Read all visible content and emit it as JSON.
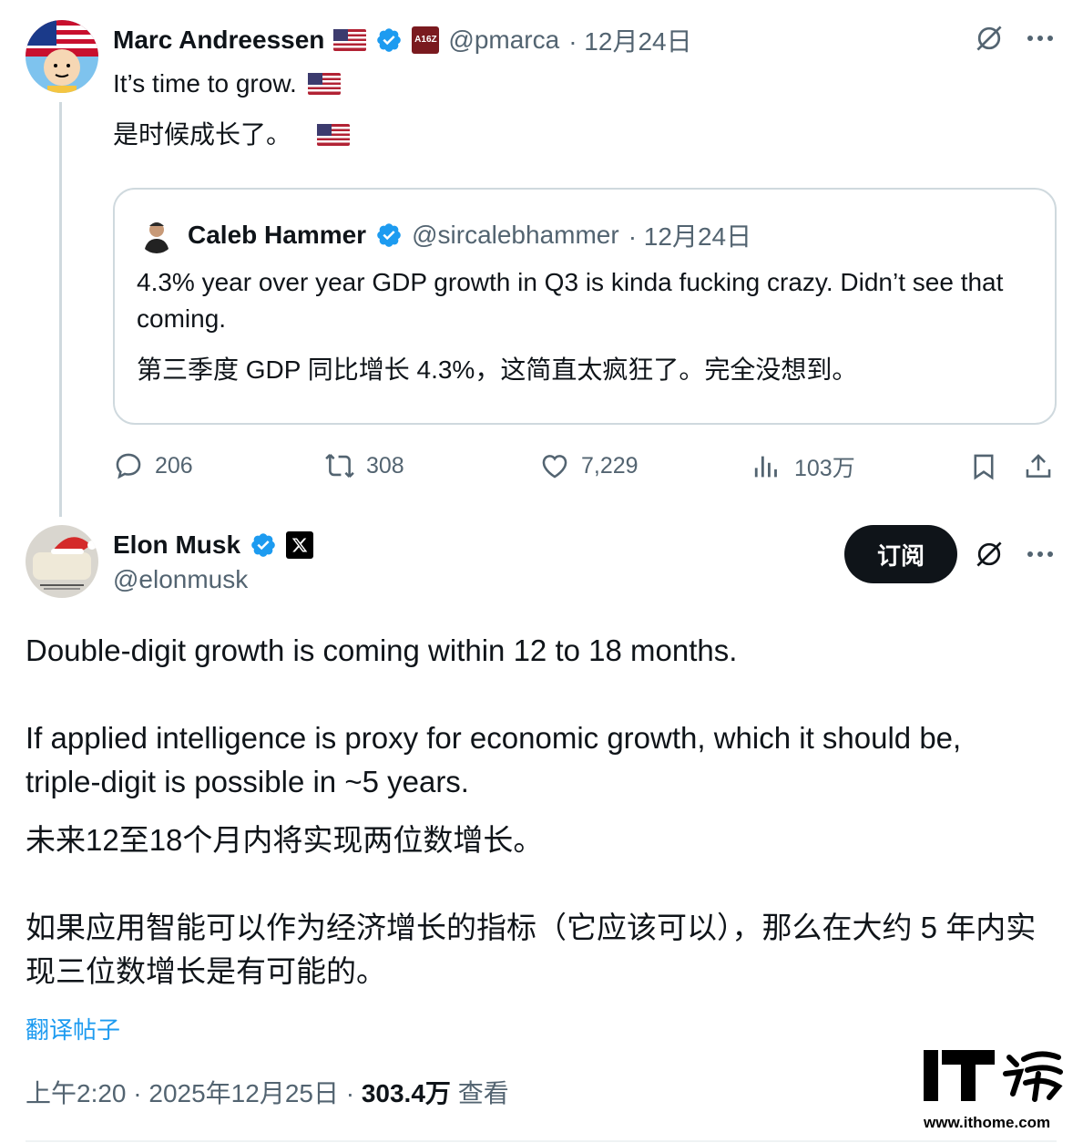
{
  "quoted_thread": {
    "author": {
      "name": "Marc Andreessen",
      "handle": "@pmarca",
      "date": "· 12月24日",
      "badge_text": "A16Z"
    },
    "text_en": "It’s time to grow.",
    "text_zh": "是时候成长了。",
    "quote": {
      "name": "Caleb Hammer",
      "handle": "@sircalebhammer",
      "date": "· 12月24日",
      "text_en": "4.3% year over year GDP growth in Q3 is kinda fucking crazy. Didn’t see that coming.",
      "text_zh": "第三季度 GDP 同比增长 4.3%，这简直太疯狂了。完全没想到。"
    },
    "actions": {
      "replies": "206",
      "reposts": "308",
      "likes": "7,229",
      "views": "103万"
    }
  },
  "main_post": {
    "author": {
      "name": "Elon Musk",
      "handle": "@elonmusk"
    },
    "subscribe_label": "订阅",
    "paragraphs_en": [
      "Double-digit growth is coming within 12 to 18 months.",
      "If applied intelligence is proxy for economic growth, which it should be, triple-digit is possible in ~5 years."
    ],
    "paragraphs_zh": [
      "未来12至18个月内将实现两位数增长。",
      "如果应用智能可以作为经济增长的指标（它应该可以），那么在大约 5 年内实现三位数增长是有可能的。"
    ],
    "translate_label": "翻译帖子",
    "timestamp": "上午2:20 · 2025年12月25日 ·",
    "view_count": "303.4万",
    "view_label": "查看"
  },
  "watermark": {
    "brand": "IT之家",
    "url": "www.ithome.com"
  },
  "colors": {
    "text": "#0f1419",
    "muted": "#536471",
    "link": "#1d9bf0",
    "verified": "#1d9bf0",
    "border": "#cfd9de"
  },
  "icons": [
    "verified-icon",
    "us-flag-icon",
    "grok-icon",
    "more-icon",
    "reply-icon",
    "repost-icon",
    "like-icon",
    "views-icon",
    "bookmark-icon",
    "share-icon",
    "x-logo-icon"
  ]
}
